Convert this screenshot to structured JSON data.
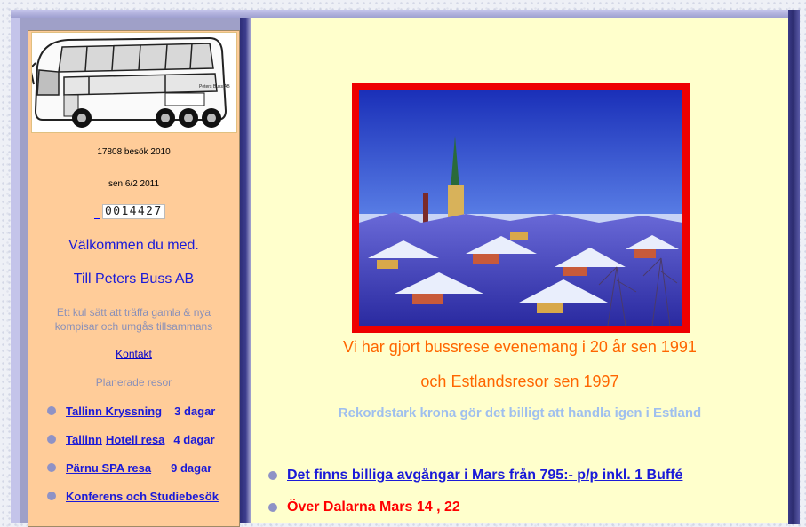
{
  "sidebar": {
    "logo_alt": "Peters Buss AB",
    "bus_sign": "Peters Buss AB",
    "visits_line": "17808 besök 2010",
    "since_line": "sen 6/2 2011",
    "counter": "0014427",
    "welcome_1": "Välkommen du med.",
    "welcome_2": "Till Peters Buss AB",
    "lead": "Ett kul sätt att träffa  gamla & nya kompisar och umgås tillsammans",
    "contact_label": "Kontakt",
    "planned_label": "Planerade resor",
    "tours": [
      {
        "name": "Tallinn  Kryssning",
        "days": "3 dagar"
      },
      {
        "name": "Tallinn",
        "extra": "Hotell resa",
        "days": "4 dagar"
      },
      {
        "name": "Pärnu  SPA resa",
        "days": "9 dagar"
      },
      {
        "name": "Konferens och Studiebesök",
        "days": ""
      }
    ]
  },
  "main": {
    "photo_alt": "Tallinn",
    "line_1": "Vi har gjort bussrese evenemang i 20 år sen 1991",
    "line_2": "och Estlandsresor sen 1997",
    "line_3": "Rekordstark krona gör det billigt att handla igen i Estland",
    "news": [
      {
        "text": "Det finns billiga avgångar  i  Mars från 795:- p/p  inkl. 1 Buffé"
      },
      {
        "text": "Över Dalarna    Mars  14 , 22"
      }
    ]
  },
  "colors": {
    "sidebar_bg": "#ffcc99",
    "main_bg": "#ffffcc",
    "link_blue": "#1a1ad8",
    "orange": "#ff6600",
    "red_frame": "#ee0000"
  }
}
